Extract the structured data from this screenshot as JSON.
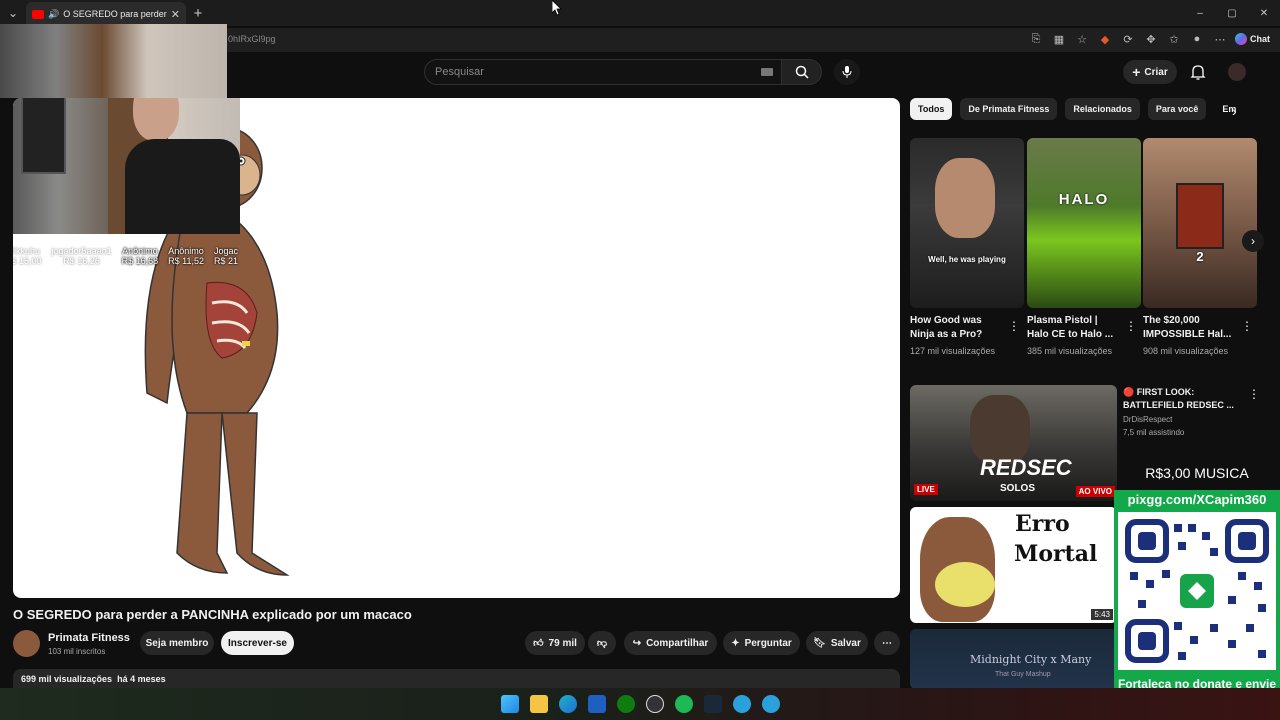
{
  "browser": {
    "tab_title": "O SEGREDO para perder a PA",
    "url_fragment": "0hIRxGl9pg",
    "chat_label": "Chat",
    "window_controls": [
      "–",
      "▢",
      "✕"
    ]
  },
  "youtube_header": {
    "search_placeholder": "Pesquisar",
    "create_label": "Criar"
  },
  "overlay": {
    "donors": [
      {
        "name": "Mikkuhu",
        "amount": "R$ 15,00",
        "faded": true
      },
      {
        "name": "jogador5aaao1",
        "amount": "R$ 16,26",
        "faded": true
      },
      {
        "name": "Anônimo",
        "amount": "R$ 16,68",
        "faded": false
      },
      {
        "name": "Anônimo",
        "amount": "R$ 11,52",
        "faded": false
      },
      {
        "name": "Jogac",
        "amount": "R$ 21",
        "faded": false
      }
    ],
    "donate_price": "R$3,00 MUSICA",
    "donate_url": "pixgg.com/XCapim360",
    "donate_message": "Fortaleça no donate e envie sua mensagem!"
  },
  "video": {
    "title": "O SEGREDO para perder a PANCINHA explicado por um macaco",
    "channel_name": "Primata Fitness",
    "subscribers": "103 mil inscritos",
    "member_label": "Seja membro",
    "subscribe_label": "Inscrever-se",
    "likes": "79 mil",
    "share_label": "Compartilhar",
    "ask_label": "Perguntar",
    "save_label": "Salvar",
    "views": "699 mil visualizações",
    "published": "há 4 meses"
  },
  "chips": [
    "Todos",
    "De Primata Fitness",
    "Relacionados",
    "Para você",
    "Em"
  ],
  "shorts": [
    {
      "title": "How Good was Ninja as a Pro?",
      "views": "127 mil visualizações",
      "caption": "Well, he was playing"
    },
    {
      "title": "Plasma Pistol | Halo CE to Halo ...",
      "views": "385 mil visualizações",
      "caption": "HALO"
    },
    {
      "title": "The $20,000 IMPOSSIBLE Hal...",
      "views": "908 mil visualizações",
      "caption": "2"
    }
  ],
  "recommendations": [
    {
      "title": "🔴 FIRST LOOK: BATTLEFIELD REDSEC ...",
      "channel": "DrDisRespect",
      "meta": "7,5 mil assistindo",
      "badge_live": "LIVE",
      "badge_aovivo": "AO VIVO",
      "thumb_text": "REDSEC",
      "thumb_sub": "SOLOS"
    },
    {
      "thumb_text_1": "Erro",
      "thumb_text_2": "Mortal",
      "duration": "5:43"
    },
    {
      "thumb_text_1": "Midnight City x Many",
      "thumb_text_2": "That Guy Mashup"
    }
  ],
  "taskbar_icons": [
    "windows-icon",
    "file-explorer-icon",
    "edge-icon",
    "outlook-icon",
    "xbox-icon",
    "obs-icon",
    "spotify-icon",
    "steam-icon",
    "telegram-icon",
    "telegram-icon-2"
  ]
}
